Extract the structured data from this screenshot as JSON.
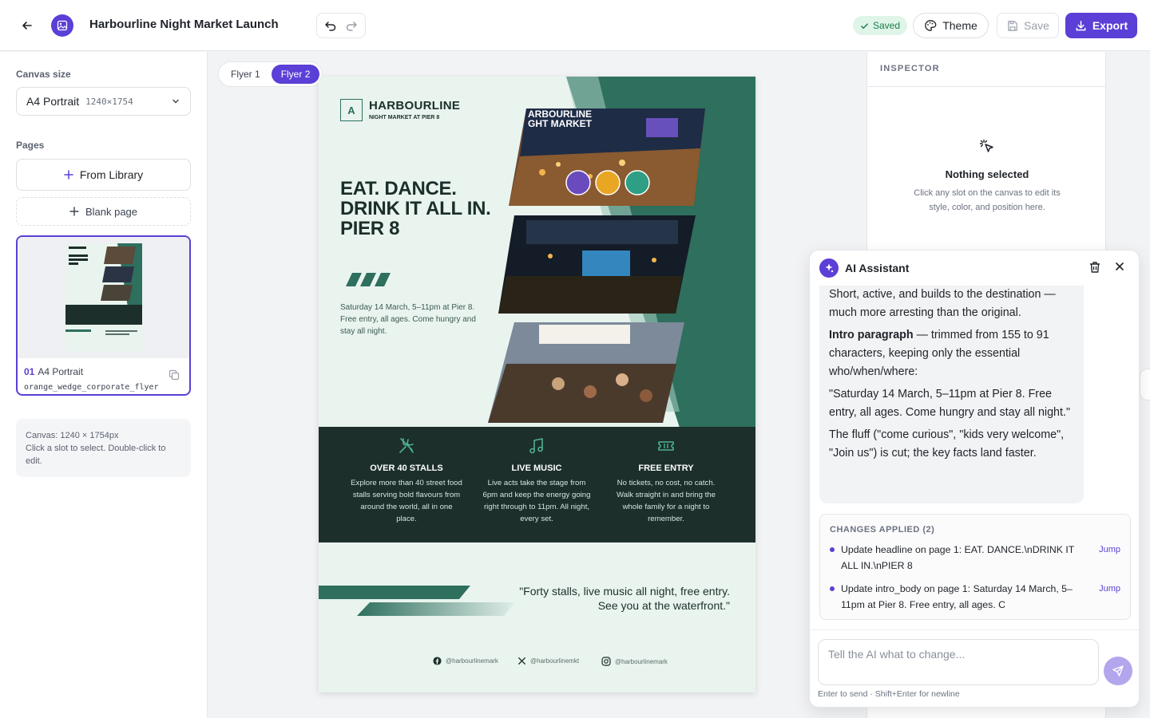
{
  "header": {
    "title": "Harbourline Night Market Launch",
    "saved_label": "Saved",
    "theme_label": "Theme",
    "save_label": "Save",
    "export_label": "Export",
    "accent": "#5b3fd6"
  },
  "sidebar": {
    "canvas_size_label": "Canvas size",
    "canvas_size_value": "A4 Portrait",
    "canvas_size_dims": "1240×1754",
    "pages_label": "Pages",
    "from_library_label": "From Library",
    "blank_page_label": "Blank page",
    "page": {
      "number": "01",
      "name": "A4 Portrait",
      "template": "orange_wedge_corporate_flyer"
    },
    "info": {
      "line1": "Canvas: 1240 × 1754px",
      "line2": "Click a slot to select. Double-click to edit."
    }
  },
  "canvas": {
    "tabs": [
      "Flyer 1",
      "Flyer 2"
    ],
    "active_tab": "Flyer 2"
  },
  "flyer": {
    "brand_initial": "A",
    "brand_name": "HARBOURLINE",
    "brand_sub": "NIGHT MARKET AT PIER 8",
    "headline": "EAT. DANCE.\nDRINK IT ALL IN.\nPIER 8",
    "intro": "Saturday 14 March, 5–11pm at Pier 8. Free entry, all ages. Come hungry and stay all night.",
    "photo_label": "ARBOURLINE\nGHT MARKET",
    "features": [
      {
        "title": "OVER 40 STALLS",
        "body": "Explore more than 40 street food stalls serving bold flavours from around the world, all in one place.",
        "icon": "utensils-icon"
      },
      {
        "title": "LIVE MUSIC",
        "body": "Live acts take the stage from 6pm and keep the energy going right through to 11pm. All night, every set.",
        "icon": "music-note-icon"
      },
      {
        "title": "FREE ENTRY",
        "body": "No tickets, no cost, no catch. Walk straight in and bring the whole family for a night to remember.",
        "icon": "ticket-icon"
      }
    ],
    "quote": "\"Forty stalls, live music all night, free entry. See you at the waterfront.\"",
    "social": [
      {
        "icon": "facebook-icon",
        "handle": "@harbourlinemark"
      },
      {
        "icon": "x-icon",
        "handle": "@harbourlinemkt"
      },
      {
        "icon": "instagram-icon",
        "handle": "@harbourlinemark"
      }
    ],
    "colors": {
      "dark": "#1c2f2b",
      "green": "#2e6f5e",
      "bg": "#e9f4ef"
    }
  },
  "inspector": {
    "title": "INSPECTOR",
    "empty_title": "Nothing selected",
    "empty_body": "Click any slot on the canvas to edit its style, color, and position here."
  },
  "ai": {
    "title": "AI Assistant",
    "message": {
      "p1": "Short, active, and builds to the destination — much more arresting than the original.",
      "p2_bold": "Intro paragraph",
      "p2_rest": " — trimmed from 155 to 91 characters, keeping only the essential who/when/where:",
      "p3": "\"Saturday 14 March, 5–11pm at Pier 8. Free entry, all ages. Come hungry and stay all night.\"",
      "p4": "The fluff (\"come curious\", \"kids very welcome\", \"Join us\") is cut; the key facts land faster."
    },
    "changes_title": "CHANGES APPLIED (2)",
    "changes": [
      {
        "text": "Update headline on page 1: EAT. DANCE.\\nDRINK IT ALL IN.\\nPIER 8",
        "action": "Jump"
      },
      {
        "text": "Update intro_body on page 1: Saturday 14 March, 5–11pm at Pier 8. Free entry, all ages. C",
        "action": "Jump"
      }
    ],
    "input_placeholder": "Tell the AI what to change...",
    "hint": "Enter to send · Shift+Enter for newline"
  }
}
